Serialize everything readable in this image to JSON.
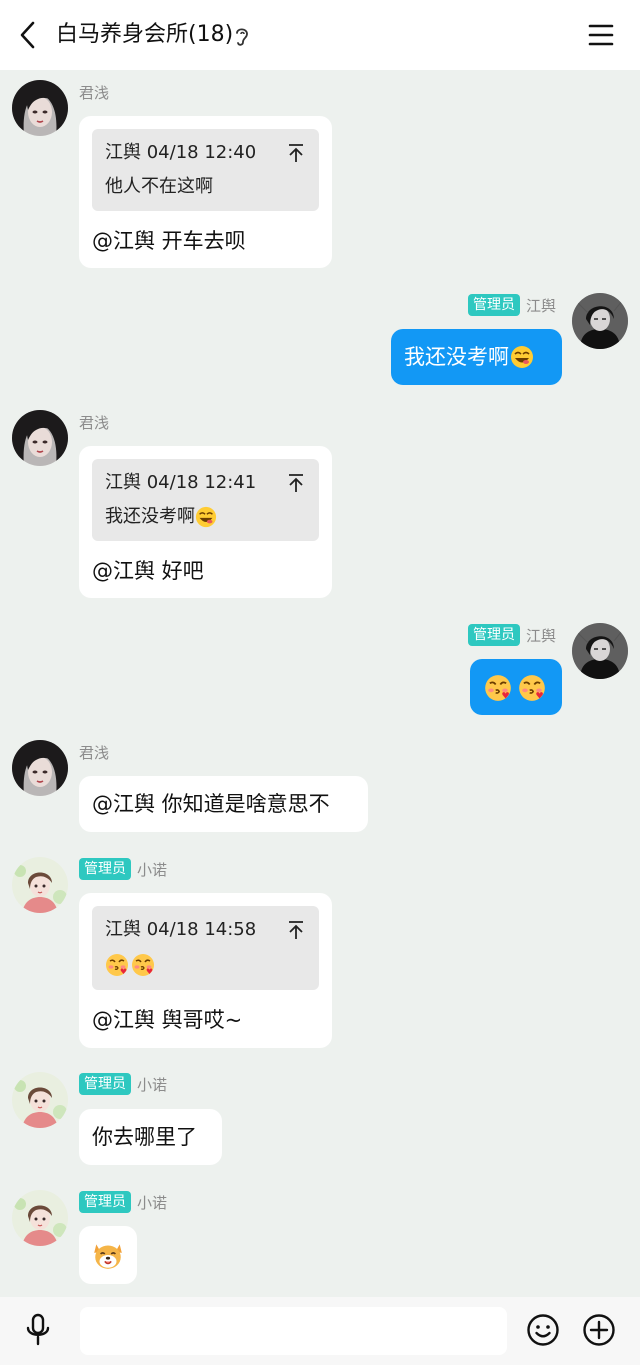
{
  "header": {
    "title": "白马养身会所(18)"
  },
  "messages": [
    {
      "sender": "君浅",
      "quote_head": "江舆 04/18 12:40",
      "quote_body": "他人不在这啊",
      "reply": "@江舆 开车去呗"
    },
    {
      "badge": "管理员",
      "sender": "江舆",
      "text": "我还没考啊"
    },
    {
      "sender": "君浅",
      "quote_head": "江舆 04/18 12:41",
      "quote_body": "我还没考啊",
      "reply": "@江舆 好吧"
    },
    {
      "badge": "管理员",
      "sender": "江舆",
      "emojis": [
        "kiss-emoji",
        "kiss-emoji"
      ]
    },
    {
      "sender": "君浅",
      "text": "@江舆 你知道是啥意思不"
    },
    {
      "badge": "管理员",
      "sender": "小诺",
      "quote_head": "江舆 04/18 14:58",
      "quote_emojis": [
        "kiss-emoji",
        "kiss-emoji"
      ],
      "reply": "@江舆 舆哥哎~"
    },
    {
      "badge": "管理员",
      "sender": "小诺",
      "text": "你去哪里了"
    },
    {
      "badge": "管理员",
      "sender": "小诺",
      "emojis": [
        "dog-emoji"
      ]
    }
  ],
  "footer": {
    "input_placeholder": "",
    "icons": [
      "microphone-icon",
      "smiley-icon",
      "plus-icon"
    ]
  },
  "colors": {
    "background": "#edf1ee",
    "my_bubble": "#1298f5",
    "badge": "#2ec8c0"
  }
}
